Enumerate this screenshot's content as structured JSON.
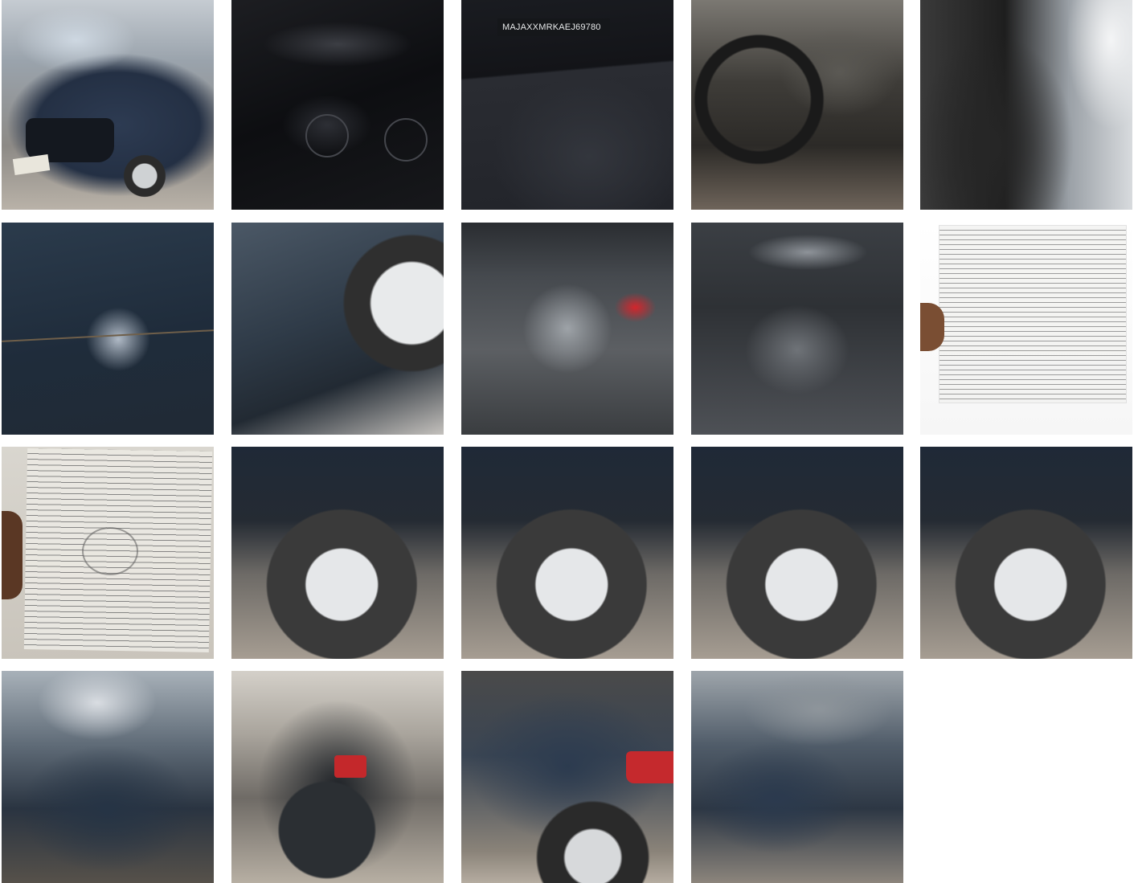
{
  "gallery": {
    "photos": [
      {
        "row": 0,
        "col": 0,
        "icon": "car-front-photo"
      },
      {
        "row": 0,
        "col": 1,
        "icon": "dashboard-gauges-photo"
      },
      {
        "row": 0,
        "col": 2,
        "icon": "vin-display-photo",
        "text": "MAJAXXMRKAEJ69780"
      },
      {
        "row": 0,
        "col": 3,
        "icon": "steering-wheel-photo"
      },
      {
        "row": 0,
        "col": 4,
        "icon": "seat-photo"
      },
      {
        "row": 1,
        "col": 0,
        "icon": "body-panel-scratch-photo"
      },
      {
        "row": 1,
        "col": 1,
        "icon": "front-fender-photo"
      },
      {
        "row": 1,
        "col": 2,
        "icon": "engine-bay-photo"
      },
      {
        "row": 1,
        "col": 3,
        "icon": "engine-bay-photo"
      },
      {
        "row": 1,
        "col": 4,
        "icon": "insurance-document-photo"
      },
      {
        "row": 2,
        "col": 0,
        "icon": "registration-document-photo"
      },
      {
        "row": 2,
        "col": 1,
        "icon": "tyre-photo"
      },
      {
        "row": 2,
        "col": 2,
        "icon": "tyre-photo"
      },
      {
        "row": 2,
        "col": 3,
        "icon": "tyre-photo"
      },
      {
        "row": 2,
        "col": 4,
        "icon": "tyre-photo"
      },
      {
        "row": 3,
        "col": 0,
        "icon": "car-front-photo"
      },
      {
        "row": 3,
        "col": 1,
        "icon": "car-rear-photo"
      },
      {
        "row": 3,
        "col": 2,
        "icon": "car-side-photo"
      },
      {
        "row": 3,
        "col": 3,
        "icon": "car-front-photo"
      }
    ]
  }
}
